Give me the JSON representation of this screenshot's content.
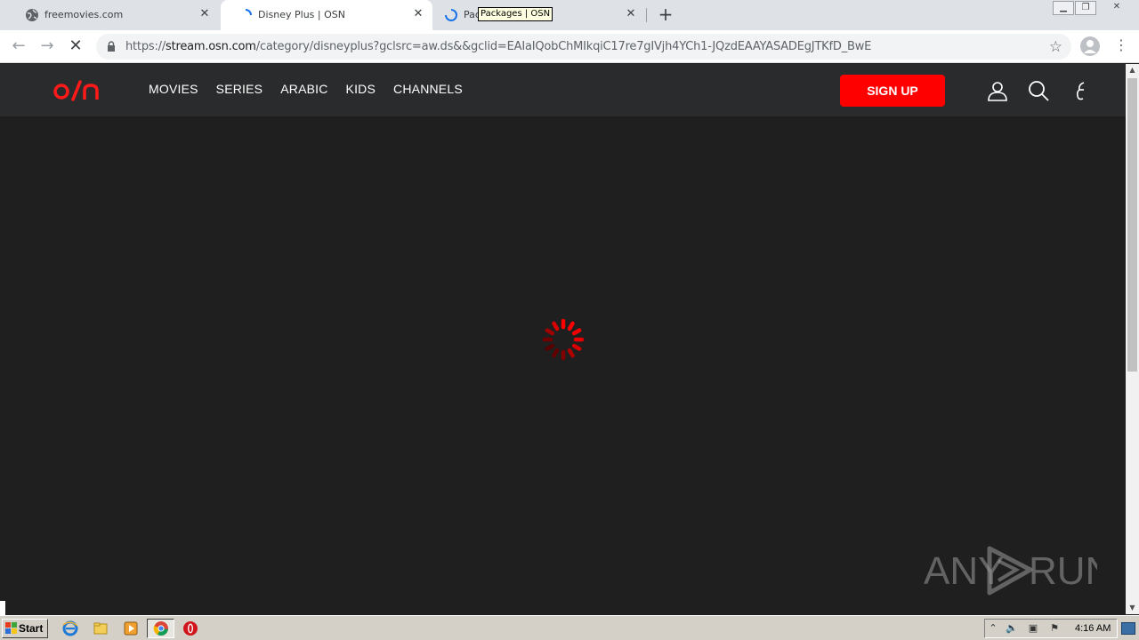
{
  "browser": {
    "tabs": [
      {
        "title": "freemovies.com",
        "favicon": "globe-icon",
        "active": false
      },
      {
        "title": "Disney Plus | OSN",
        "favicon": "loading-spinner-icon",
        "active": true
      },
      {
        "title": "Pac",
        "favicon": "loading-spinner-icon",
        "active": false
      }
    ],
    "tooltip": "Packages | OSN",
    "url_scheme": "https://",
    "url_host": "stream.osn.com",
    "url_path": "/category/disneyplus?gclsrc=aw.ds&&gclid=EAIaIQobChMIkqiC17re7gIVjh4YCh1-JQzdEAAYASADEgJTKfD_BwE"
  },
  "site": {
    "brand": "osn",
    "nav": [
      "MOVIES",
      "SERIES",
      "ARABIC",
      "KIDS",
      "CHANNELS"
    ],
    "signup_label": "SIGN UP",
    "accent": "#ff0000",
    "background": "#1f1f20"
  },
  "watermark": {
    "left": "ANY",
    "right": "RUN"
  },
  "taskbar": {
    "start_label": "Start",
    "clock": "4:16 AM"
  }
}
